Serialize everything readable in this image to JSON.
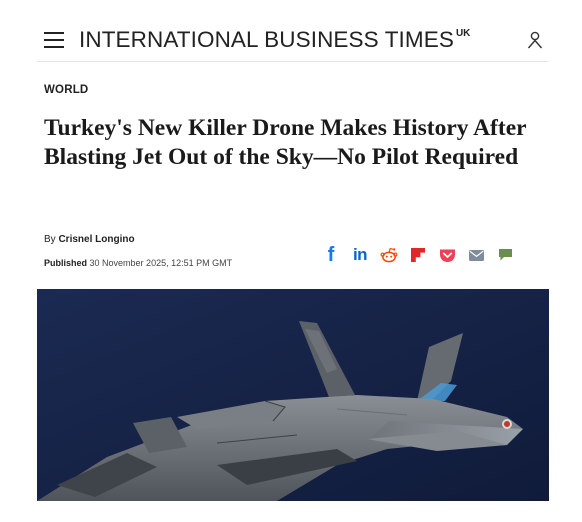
{
  "header": {
    "brand": "INTERNATIONAL BUSINESS TIMES",
    "edition": "UK",
    "icons": {
      "menu": "hamburger-menu-icon",
      "account": "user-account-icon"
    }
  },
  "article": {
    "section": "WORLD",
    "headline": "Turkey's New Killer Drone Makes History After Blasting Jet Out of the Sky—No Pilot Required",
    "byline_prefix": "By",
    "author": "Crisnel Longino",
    "published_label": "Published",
    "published_date": "30 November 2025, 12:51 PM GMT"
  },
  "share": {
    "facebook_glyph": "f",
    "linkedin_glyph": "in",
    "icons": [
      "facebook-icon",
      "linkedin-icon",
      "reddit-icon",
      "flipboard-icon",
      "pocket-icon",
      "email-icon",
      "comment-icon"
    ]
  },
  "hero_image": {
    "subject": "gray stealth fighter jet",
    "background_color": "#16244a"
  },
  "colors": {
    "facebook": "#1877f2",
    "linkedin": "#0a66c2",
    "reddit": "#ff4500",
    "flipboard": "#e12828",
    "pocket": "#ef4056",
    "email": "#7f8c9a",
    "comment": "#6b8e4e"
  }
}
